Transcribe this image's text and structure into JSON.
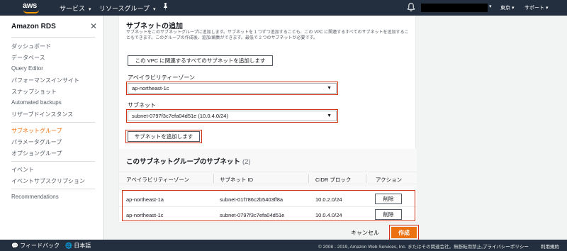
{
  "topnav": {
    "logo": "aws",
    "services": "サービス",
    "resource_groups": "リソースグループ",
    "pin_icon": "pin-icon",
    "bell_icon": "bell-icon",
    "region": "東京",
    "support": "サポート"
  },
  "sidebar": {
    "title": "Amazon RDS",
    "items": [
      {
        "label": "ダッシュボード"
      },
      {
        "label": "データベース"
      },
      {
        "label": "Query Editor"
      },
      {
        "label": "パフォーマンスインサイト"
      },
      {
        "label": "スナップショット"
      },
      {
        "label": "Automated backups"
      },
      {
        "label": "リザーブドインスタンス"
      },
      {
        "label": "サブネットグループ"
      },
      {
        "label": "パラメータグループ"
      },
      {
        "label": "オプショングループ"
      },
      {
        "label": "イベント"
      },
      {
        "label": "イベントサブスクリプション"
      },
      {
        "label": "Recommendations"
      }
    ]
  },
  "add_subnets": {
    "title": "サブネットの追加",
    "description": "サブネットをこのサブネットグループに追加します。サブネットを 1 つずつ追加することも、この VPC に関連するすべてのサブネットを追加することもできます。このグループの作成後、追加/編集ができます。最低で 2 つのサブネットが必要です。",
    "add_all_button": "この VPC に関連するすべてのサブネットを追加します",
    "az_label": "アベイラビリティーゾーン",
    "az_value": "ap-northeast-1c",
    "subnet_label": "サブネット",
    "subnet_value": "subnet-0797f3c7efa04d51e (10.0.4.0/24)",
    "add_subnet_button": "サブネットを追加します"
  },
  "group_subnets": {
    "title": "このサブネットグループのサブネット",
    "count": "(2)",
    "headers": [
      "アベイラビリティーゾーン",
      "サブネット ID",
      "CIDR ブロック",
      "アクション"
    ],
    "rows": [
      {
        "az": "ap-northeast-1a",
        "subnet_id": "subnet-01f786c2b5403ff8a",
        "cidr": "10.0.2.0/24",
        "action": "削除"
      },
      {
        "az": "ap-northeast-1c",
        "subnet_id": "subnet-0797f3c7efa04d51e",
        "cidr": "10.0.4.0/24",
        "action": "削除"
      }
    ]
  },
  "actions": {
    "cancel": "キャンセル",
    "create": "作成"
  },
  "footer": {
    "feedback": "フィードバック",
    "language": "日本語",
    "copyright": "© 2008 - 2019, Amazon Web Services, Inc. またはその関連会社。無断転用禁止。",
    "privacy": "プライバシーポリシー",
    "terms": "利用規約"
  }
}
